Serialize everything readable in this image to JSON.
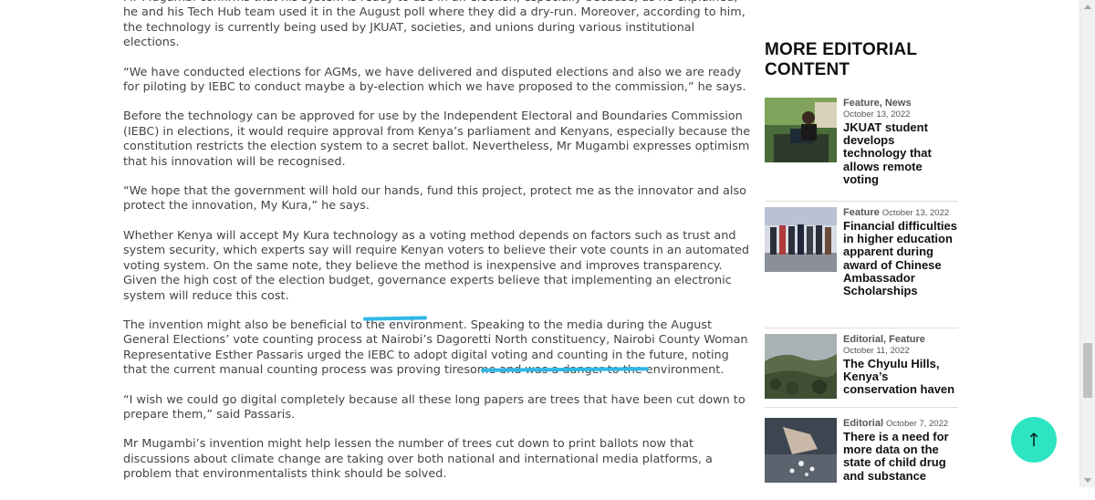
{
  "article": {
    "paragraphs": [
      "Mr Mugambi confirms that his system is ready to use in an election, especially because, as he explained, he and his Tech Hub team used it in the August poll where they did a dry-run. Moreover, according to him, the technology is currently being used by JKUAT, societies, and unions during various institutional elections.",
      "“We have conducted elections for AGMs, we have delivered and disputed elections and also we are ready for piloting by IEBC to conduct maybe a by-election which we have proposed to the commission,” he says.",
      "Before the technology can be approved for use by the Independent Electoral and Boundaries Commission (IEBC) in elections, it would require approval from Kenya’s parliament and Kenyans, especially because the constitution restricts the election system to a secret ballot. Nevertheless, Mr Mugambi expresses optimism that his innovation will be recognised.",
      "“We hope that the government will hold our hands, fund this project, protect me as the innovator and also protect the innovation, My Kura,” he says.",
      "Whether Kenya will accept My Kura technology as a voting method depends on factors such as trust and system security, which experts say will require Kenyan voters to believe their vote counts in an automated voting system. On the same note, they believe the method is inexpensive and improves transparency. Given the high cost of the election budget, governance experts believe that implementing an electronic system will reduce this cost.",
      "The invention might also be beneficial to the environment. Speaking to the media during the August General Elections’ vote counting process at Nairobi’s Dagoretti North constituency, Nairobi County Woman Representative Esther Passaris urged the IEBC to adopt digital voting and counting in the future, noting that the current manual counting process was proving tiresome and was a danger to the environment.",
      "“I wish we could go digital completely because all these long papers are trees that have been cut down to prepare them,” said Passaris.",
      "Mr Mugambi’s invention might help lessen the number of trees cut down to print ballots now that discussions about climate change are taking over both national and international media platforms, a problem that environmentalists think should be solved."
    ]
  },
  "sidebar": {
    "heading": "MORE EDITORIAL CONTENT",
    "cards": [
      {
        "cats": "Feature, News",
        "date": "October 13, 2022",
        "title": "JKUAT student develops technology that allows remote voting"
      },
      {
        "cats": "Feature",
        "date": "October 13, 2022",
        "title": "Financial difficulties in higher education apparent during award of Chinese Ambassador Scholarships"
      },
      {
        "cats": "Editorial, Feature",
        "date": "October 11, 2022",
        "title": "The Chyulu Hills, Kenya’s conservation haven"
      },
      {
        "cats": "Editorial",
        "date": "October 7, 2022",
        "title": "There is a need for more data on the state of child drug and substance"
      }
    ]
  },
  "back_to_top": {
    "symbol": "↑"
  },
  "colors": {
    "highlight": "#2fb8e6",
    "top_button": "#2ee5c3"
  }
}
